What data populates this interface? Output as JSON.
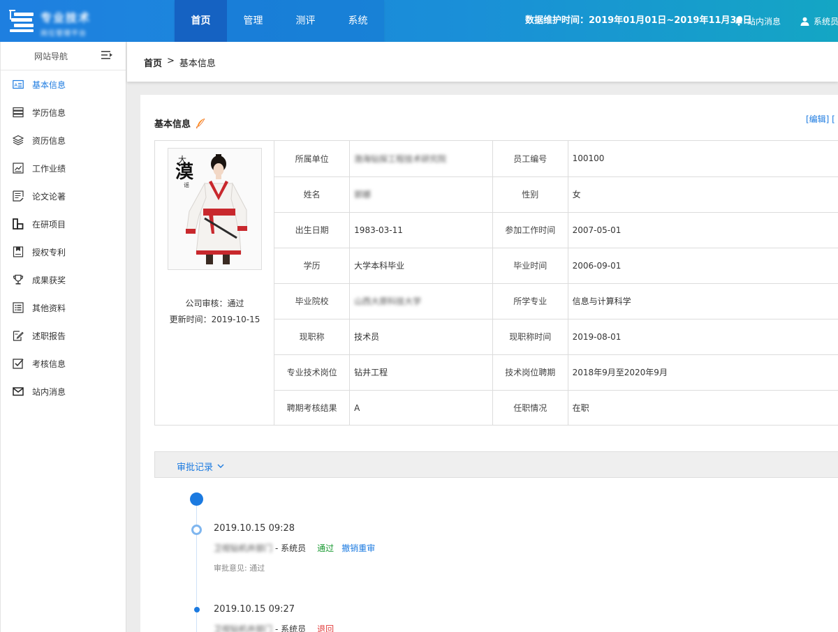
{
  "header": {
    "logo_line1": "专业技术",
    "logo_line2": "岗位管理平台",
    "nav": [
      "首页",
      "管理",
      "测评",
      "系统"
    ],
    "active_nav": "首页",
    "maintenance": "数据维护时间：2019年01月01日~2019年11月30日",
    "messages": "站内消息",
    "user": "系统员"
  },
  "sidebar": {
    "title": "网站导航",
    "items": [
      {
        "label": "基本信息",
        "icon": "id-card-icon",
        "active": true
      },
      {
        "label": "学历信息",
        "icon": "stack-icon"
      },
      {
        "label": "资历信息",
        "icon": "layers-icon"
      },
      {
        "label": "工作业绩",
        "icon": "chart-icon"
      },
      {
        "label": "论文论著",
        "icon": "document-edit-icon"
      },
      {
        "label": "在研项目",
        "icon": "blocks-icon"
      },
      {
        "label": "授权专利",
        "icon": "certificate-icon"
      },
      {
        "label": "成果获奖",
        "icon": "trophy-icon"
      },
      {
        "label": "其他资料",
        "icon": "list-icon"
      },
      {
        "label": "述职报告",
        "icon": "pen-paper-icon"
      },
      {
        "label": "考核信息",
        "icon": "checkbox-icon"
      },
      {
        "label": "站内消息",
        "icon": "mail-icon"
      }
    ]
  },
  "breadcrumb": {
    "home": "首页",
    "sep": ">",
    "current": "基本信息"
  },
  "section": {
    "title": "基本信息",
    "edit_link": "[编辑] [",
    "accent": "#1b7ae0"
  },
  "profile": {
    "audit": "公司审核：通过",
    "updated": "更新时间：2019-10-15",
    "photo_caption": "大漠谣"
  },
  "info": {
    "rows": [
      {
        "k1": "所属单位",
        "v1": "渤海钻探工程技术研究院",
        "k2": "员工编号",
        "v2": "100100"
      },
      {
        "k1": "姓名",
        "v1": "郭娜",
        "k2": "性别",
        "v2": "女"
      },
      {
        "k1": "出生日期",
        "v1": "1983-03-11",
        "k2": "参加工作时间",
        "v2": "2007-05-01"
      },
      {
        "k1": "学历",
        "v1": "大学本科毕业",
        "k2": "毕业时间",
        "v2": "2006-09-01"
      },
      {
        "k1": "毕业院校",
        "v1": "山西大原科技大学",
        "k2": "所学专业",
        "v2": "信息与计算科学"
      },
      {
        "k1": "现职称",
        "v1": "技术员",
        "k2": "现职称时间",
        "v2": "2019-08-01"
      },
      {
        "k1": "专业技术岗位",
        "v1": "钻井工程",
        "k2": "技术岗位聘期",
        "v2": "2018年9月至2020年9月"
      },
      {
        "k1": "聘期考核结果",
        "v1": "A",
        "k2": "任职情况",
        "v2": "在职"
      }
    ]
  },
  "approval": {
    "title": "审批记录",
    "entries": [
      {
        "time": "2019.10.15 09:28",
        "dept": "卫视钻机井部门",
        "role": "- 系统员",
        "status": "通过",
        "action": "撤销重审",
        "note": "审批意见: 通过"
      },
      {
        "time": "2019.10.15 09:27",
        "dept": "卫视钻机井部门",
        "role": "- 系统员",
        "status": "退回"
      }
    ]
  }
}
